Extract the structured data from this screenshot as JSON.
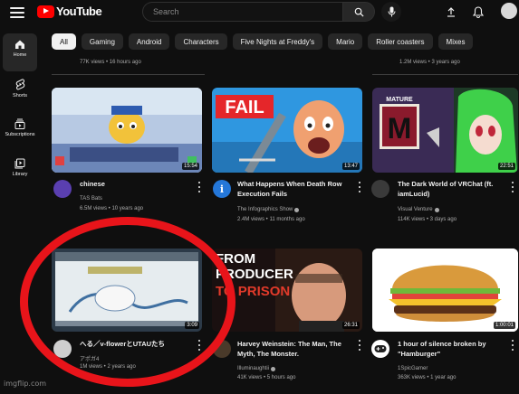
{
  "app": {
    "logo_text": "YouTube"
  },
  "search": {
    "placeholder": "Search"
  },
  "sidebar": {
    "items": [
      {
        "label": "Home",
        "icon": "home-icon",
        "active": true
      },
      {
        "label": "Shorts",
        "icon": "shorts-icon"
      },
      {
        "label": "Subscriptions",
        "icon": "subscriptions-icon"
      },
      {
        "label": "Library",
        "icon": "library-icon"
      }
    ]
  },
  "chips": [
    "All",
    "Gaming",
    "Android",
    "Characters",
    "Five Nights at Freddy's",
    "Mario",
    "Roller coasters",
    "Mixes"
  ],
  "top_row_meta": [
    "77K views • 16 hours ago",
    "1.2M views • 3 years ago"
  ],
  "videos": [
    {
      "title": "chinese",
      "channel": "TAS Bats",
      "meta": "6.5M views • 10 years ago",
      "duration": "15:54"
    },
    {
      "title": "What Happens When Death Row Execution Fails",
      "channel": "The Infographics Show",
      "verified": true,
      "meta": "2.4M views • 11 months ago",
      "duration": "13:47",
      "thumb_text": "FAIL"
    },
    {
      "title": "The Dark World of VRChat (ft. iamLucid)",
      "channel": "Visual Venture",
      "verified": true,
      "meta": "114K views • 3 days ago",
      "duration": "22:51",
      "thumb_text": "MATURE"
    },
    {
      "title": "へる／v-flowerとUTAUたち",
      "channel": "アポガ4",
      "meta": "1M views • 2 years ago",
      "duration": "3:09"
    },
    {
      "title": "Harvey Weinstein: The Man, The Myth, The Monster.",
      "channel": "Illuminaughtii",
      "verified": true,
      "meta": "41K views • 5 hours ago",
      "duration": "26:31",
      "thumb_text_1": "FROM",
      "thumb_text_2": "PRODUCER",
      "thumb_text_3": "TO PRISON"
    },
    {
      "title": "1 hour of silence broken by \"Hamburger\"",
      "channel": "1SpicGamer",
      "meta": "363K views • 1 year ago",
      "duration": "1:00:01"
    }
  ],
  "watermark": "imgflip.com",
  "colors": {
    "background": "#0f0f0f",
    "chip": "#272727",
    "chip_active": "#f1f1f1",
    "logo_red": "#ff0000",
    "annotation": "#e8141a"
  }
}
